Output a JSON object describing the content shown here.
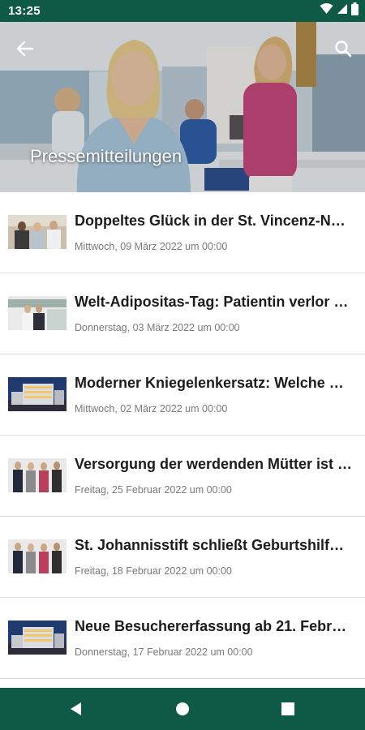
{
  "status_bar": {
    "time": "13:25",
    "icons": [
      "wifi-icon",
      "signal-icon",
      "battery-icon"
    ]
  },
  "header": {
    "title": "Pressemitteilungen",
    "back_icon": "arrow-back-icon",
    "search_icon": "search-icon"
  },
  "articles": [
    {
      "title": "Doppeltes Glück in der St. Vincenz-N…",
      "date": "Mittwoch, 09 März 2022 um 00:00",
      "thumb": "people"
    },
    {
      "title": "Welt-Adipositas-Tag: Patientin verlor …",
      "date": "Donnerstag, 03 März 2022 um 00:00",
      "thumb": "clinic"
    },
    {
      "title": "Moderner Kniegelenkersatz: Welche …",
      "date": "Mittwoch, 02 März 2022 um 00:00",
      "thumb": "building"
    },
    {
      "title": "Versorgung der werdenden Mütter ist …",
      "date": "Freitag, 25 Februar 2022 um 00:00",
      "thumb": "group"
    },
    {
      "title": "St. Johannisstift schließt Geburtshilf…",
      "date": "Freitag, 18 Februar 2022 um 00:00",
      "thumb": "group"
    },
    {
      "title": "Neue Besuchererfassung ab 21. Febr…",
      "date": "Donnerstag, 17 Februar 2022 um 00:00",
      "thumb": "building"
    }
  ],
  "nav_bar": {
    "back_icon": "nav-back-icon",
    "home_icon": "nav-home-icon",
    "recents_icon": "nav-recents-icon"
  },
  "colors": {
    "status_bar": "#0f5a47",
    "nav_bar": "#0f5a47",
    "title_text": "#1c1c1c",
    "date_text": "#7a7a7a"
  }
}
